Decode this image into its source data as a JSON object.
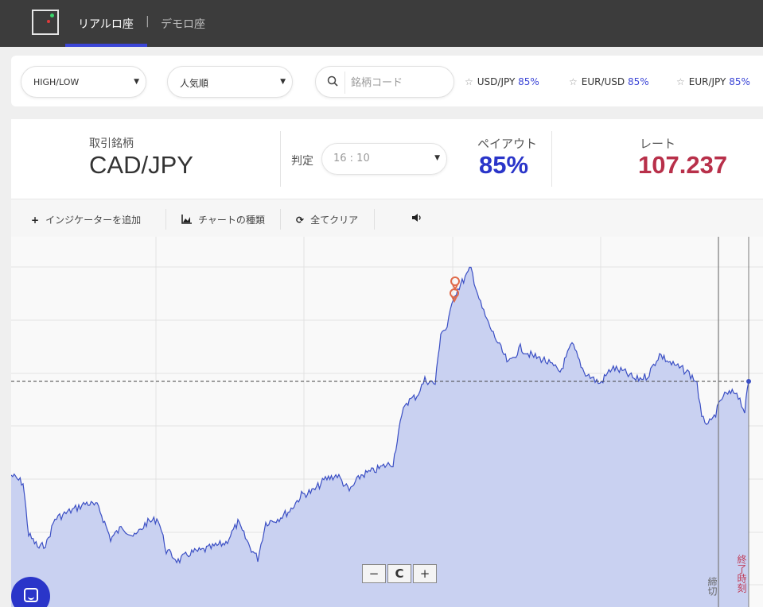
{
  "nav": {
    "logo_icon": "app-logo",
    "tabs": [
      {
        "label": "リアルロ座",
        "active": true
      },
      {
        "label": "デモロ座",
        "active": false
      }
    ],
    "separator": "|",
    "accent_color": "#3b45d6"
  },
  "filters": {
    "option_type": "HIGH/LOW",
    "sort": "人気順",
    "search": {
      "placeholder": "銘柄コード",
      "value": "",
      "icon": "search-icon"
    }
  },
  "favorites": [
    {
      "symbol": "USD/JPY",
      "payout": "85%"
    },
    {
      "symbol": "EUR/USD",
      "payout": "85%"
    },
    {
      "symbol": "EUR/JPY",
      "payout": "85%"
    }
  ],
  "trade": {
    "symbol_label": "取引銘柄",
    "symbol": "CAD/JPY",
    "expiry_label": "判定",
    "expiry": "16 : 10",
    "payout_label": "ペイアウト",
    "payout": "85%",
    "rate_label": "レート",
    "rate": "107.237",
    "payout_color": "#2a35c9",
    "rate_color": "#b8304a"
  },
  "toolbar": {
    "add_indicator": "インジケーターを追加",
    "chart_type": "チャートの種類",
    "clear_all": "全てクリア",
    "sound_icon": "speaker-icon"
  },
  "chart": {
    "zoom_out": "−",
    "reset": "C",
    "zoom_in": "+",
    "close_label": "締切",
    "expiry_label": "終了時刻",
    "line_color": "#3b4fc4",
    "fill_color": "#c9d1f1"
  }
}
